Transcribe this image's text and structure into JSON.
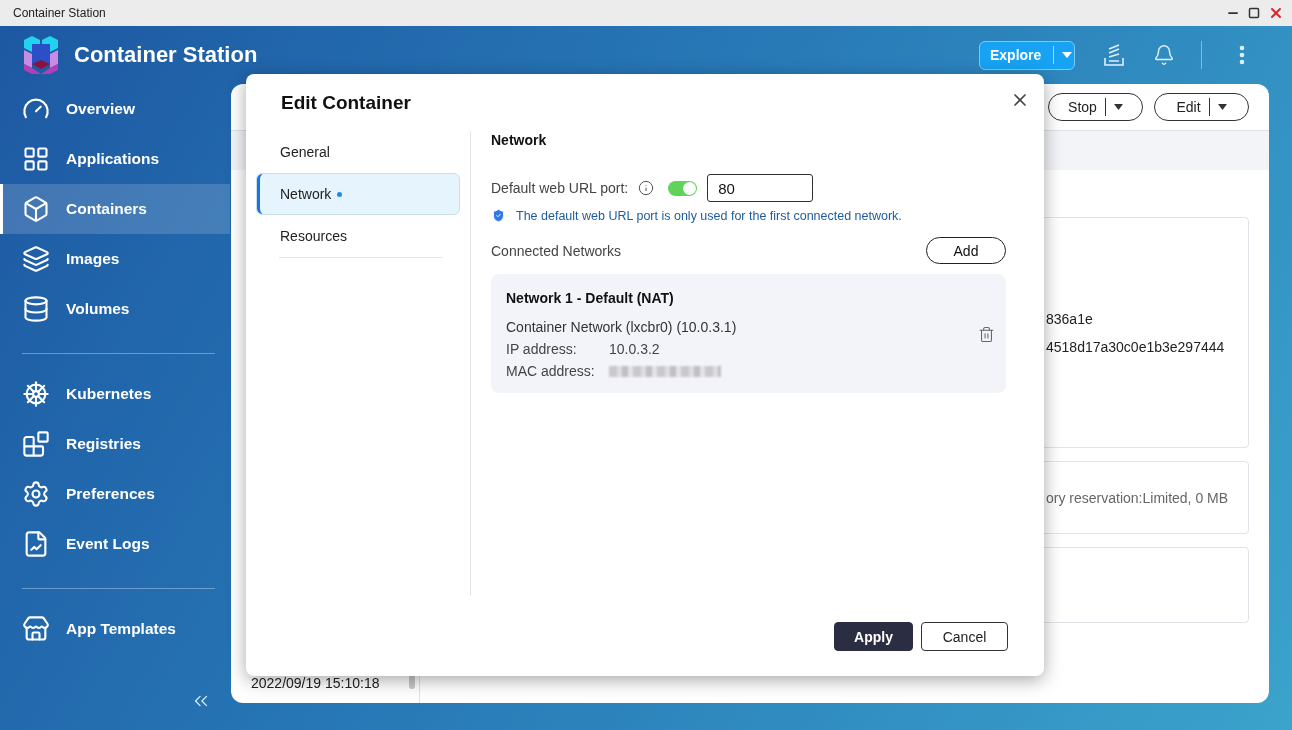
{
  "window": {
    "title": "Container Station"
  },
  "header": {
    "app_name": "Container Station",
    "explore_button": "Explore"
  },
  "sidebar": {
    "sections": [
      {
        "items": [
          {
            "label": "Overview",
            "selected": false
          },
          {
            "label": "Applications",
            "selected": false
          },
          {
            "label": "Containers",
            "selected": true
          },
          {
            "label": "Images",
            "selected": false
          },
          {
            "label": "Volumes",
            "selected": false
          }
        ]
      },
      {
        "items": [
          {
            "label": "Kubernetes",
            "selected": false
          },
          {
            "label": "Registries",
            "selected": false
          },
          {
            "label": "Preferences",
            "selected": false
          },
          {
            "label": "Event Logs",
            "selected": false
          }
        ]
      },
      {
        "items": [
          {
            "label": "App Templates",
            "selected": false
          }
        ]
      }
    ]
  },
  "background": {
    "toolbar_buttons": [
      "Stop",
      "Edit"
    ],
    "list_time": "2022/09/19 15:10:18",
    "cards": [
      {
        "kind": "text",
        "lines": [
          "836a1e",
          "4518d17a30c0e1b3e297444"
        ]
      },
      {
        "kind": "text",
        "lines": [
          "ory reservation:Limited, 0 MB"
        ]
      },
      {
        "kind": "empty"
      }
    ]
  },
  "dialog": {
    "title": "Edit Container",
    "nav": [
      {
        "label": "General",
        "selected": false,
        "modified": false
      },
      {
        "label": "Network",
        "selected": true,
        "modified": true
      },
      {
        "label": "Resources",
        "selected": false,
        "modified": false
      }
    ],
    "section_title": "Network",
    "port_label": "Default web URL port:",
    "port_enabled": true,
    "port_value": "80",
    "hint": "The default web URL port is only used for the first connected network.",
    "networks_label": "Connected Networks",
    "add_button": "Add",
    "networks": [
      {
        "name": "Network 1 - Default (NAT)",
        "adapter": "Container Network (lxcbr0) (10.0.3.1)",
        "fields": [
          {
            "label": "IP address:",
            "value": "10.0.3.2",
            "redacted": false
          },
          {
            "label": "MAC address:",
            "redacted": true
          }
        ]
      }
    ],
    "buttons": [
      {
        "label": "Apply",
        "kind": "primary"
      },
      {
        "label": "Cancel",
        "kind": "secondary"
      }
    ]
  }
}
